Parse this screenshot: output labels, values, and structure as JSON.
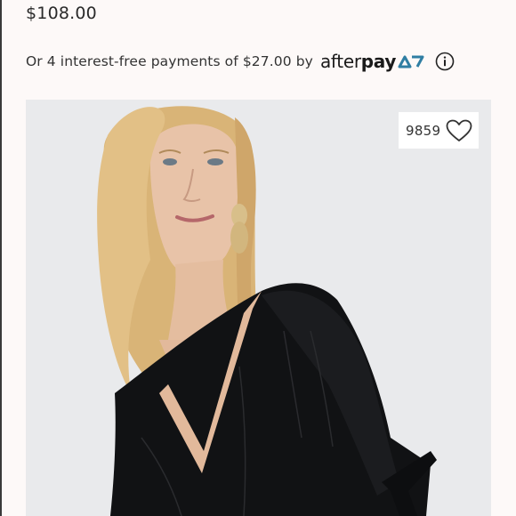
{
  "listing": {
    "price": "$108.00"
  },
  "afterpay": {
    "text": "Or 4 interest-free payments of $27.00 by",
    "logo_after": "after",
    "logo_pay": "pay",
    "info_icon": "info-icon"
  },
  "likes": {
    "count": "9859",
    "icon": "heart-outline-icon"
  },
  "colors": {
    "background": "#fdf9f8",
    "afterpay_teal": "#2f7ea3",
    "text": "#2b2b2b"
  }
}
